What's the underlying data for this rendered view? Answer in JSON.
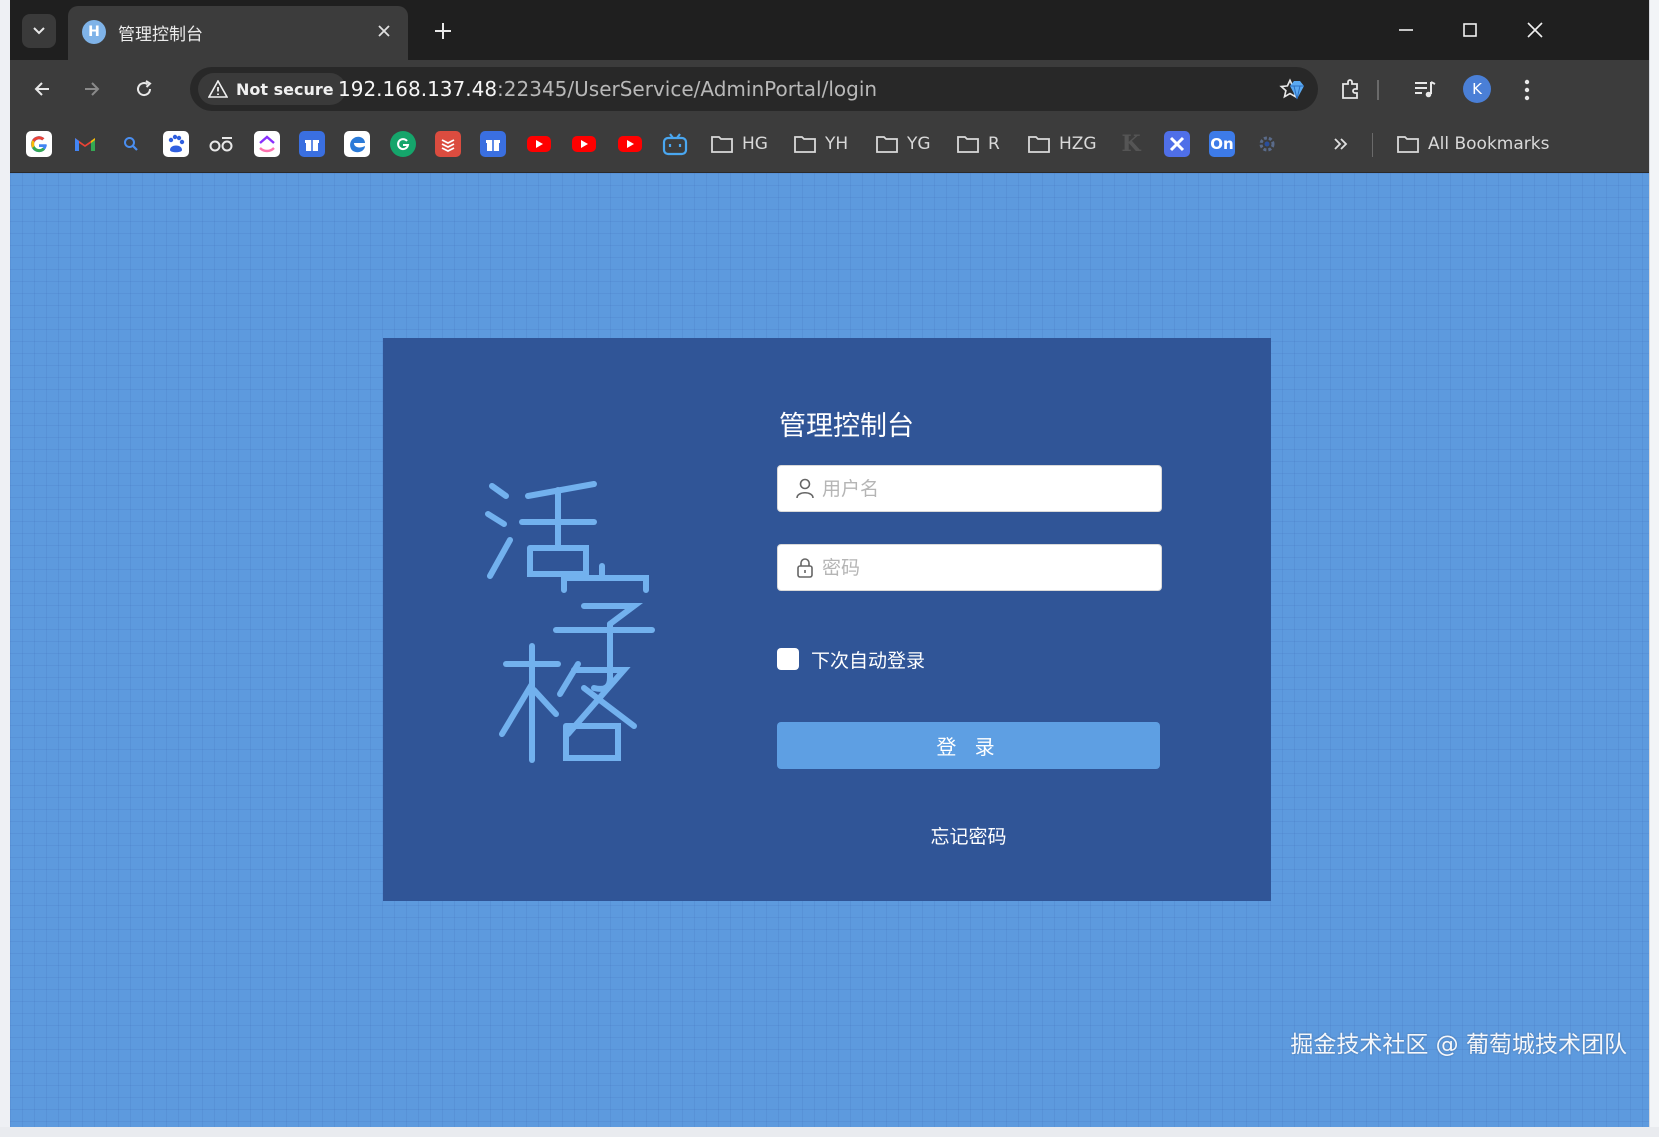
{
  "browser": {
    "tab": {
      "title": "管理控制台",
      "favicon_letter": "H"
    },
    "security": {
      "label": "Not secure"
    },
    "url": {
      "host": "192.168.137.48",
      "rest": ":22345/UserService/AdminPortal/login"
    },
    "profile_initial": "K",
    "bookmarks": {
      "apps": [
        {
          "name": "google-icon",
          "glyph": "G",
          "color": "#ffffff"
        },
        {
          "name": "gmail-icon",
          "glyph": "M",
          "color": "#ffffff"
        },
        {
          "name": "search-icon",
          "glyph": "",
          "color": "#3c3c3c"
        },
        {
          "name": "baidu-icon",
          "glyph": "du",
          "color": "#2f5fe0"
        },
        {
          "name": "hearing-icon",
          "glyph": "oo",
          "color": "#3c3c3c"
        },
        {
          "name": "clickup-icon",
          "glyph": "C",
          "color": "#ffffff"
        },
        {
          "name": "gift-icon",
          "glyph": "T",
          "color": "#3a6fe0"
        },
        {
          "name": "edge-icon",
          "glyph": "e",
          "color": "#2a7ad8"
        },
        {
          "name": "grammarly-icon",
          "glyph": "G",
          "color": "#15a56b"
        },
        {
          "name": "todoist-icon",
          "glyph": "≡",
          "color": "#db4c3f"
        },
        {
          "name": "gift-icon-2",
          "glyph": "T",
          "color": "#3a6fe0"
        },
        {
          "name": "youtube-icon",
          "glyph": "▶",
          "color": "#ff0000"
        },
        {
          "name": "youtube-icon-2",
          "glyph": "▶",
          "color": "#ff0000"
        },
        {
          "name": "youtube-icon-3",
          "glyph": "▶",
          "color": "#ff0000"
        },
        {
          "name": "bilibili-icon",
          "glyph": "tv",
          "color": "#3c3c3c"
        }
      ],
      "folders": [
        "HG",
        "YH",
        "YG",
        "R",
        "HZG"
      ],
      "apps_after": [
        {
          "name": "k-icon",
          "glyph": "K",
          "color": "#3c3c3c"
        },
        {
          "name": "tools-icon",
          "glyph": "✕",
          "color": "#4f6fe8"
        },
        {
          "name": "on-icon",
          "glyph": "On",
          "color": "#3d7be8"
        },
        {
          "name": "settings-icon",
          "glyph": "⚙",
          "color": "#3c3c3c"
        }
      ],
      "all_bookmarks": "All Bookmarks"
    }
  },
  "login": {
    "title": "管理控制台",
    "username_placeholder": "用户名",
    "password_placeholder": "密码",
    "remember_label": "下次自动登录",
    "submit_label": "登 录",
    "forgot_label": "忘记密码",
    "logo_text": "活字格"
  },
  "watermark": "掘金技术社区 @ 葡萄城技术团队",
  "colors": {
    "page_bg": "#5d9ade",
    "card_bg": "#305597",
    "button_bg": "#5e9fe3",
    "logo": "#72b1ee"
  }
}
